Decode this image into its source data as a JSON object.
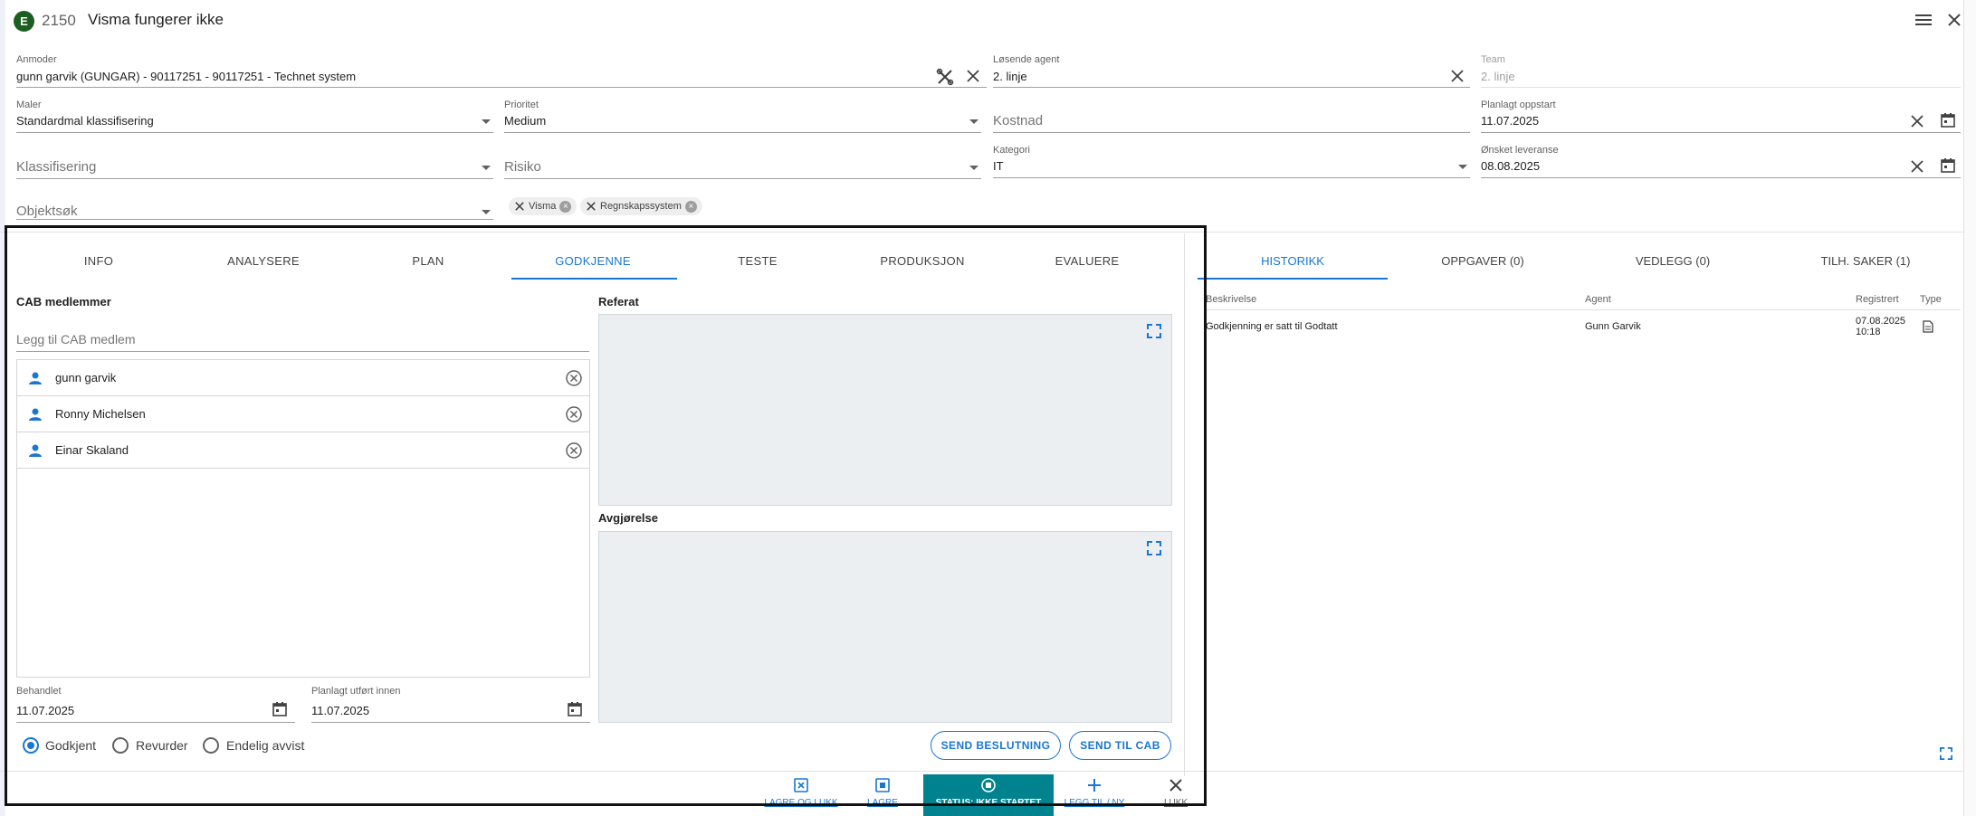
{
  "header": {
    "badge": "E",
    "case_number": "2150",
    "title": "Visma fungerer ikke"
  },
  "form": {
    "anmoder": {
      "label": "Anmoder",
      "value": "gunn garvik (GUNGAR) - 90117251 - 90117251 - Technet system"
    },
    "losende_agent": {
      "label": "Løsende agent",
      "value": "2. linje"
    },
    "team": {
      "label": "Team",
      "value": "2. linje"
    },
    "maler": {
      "label": "Maler",
      "value": "Standardmal klassifisering"
    },
    "prioritet": {
      "label": "Prioritet",
      "value": "Medium"
    },
    "kostnad": {
      "placeholder": "Kostnad"
    },
    "planlagt_oppstart": {
      "label": "Planlagt oppstart",
      "value": "11.07.2025"
    },
    "klassifisering": {
      "placeholder": "Klassifisering"
    },
    "risiko": {
      "placeholder": "Risiko"
    },
    "kategori": {
      "label": "Kategori",
      "value": "IT"
    },
    "onsket_leveranse": {
      "label": "Ønsket leveranse",
      "value": "08.08.2025"
    },
    "objektsok": {
      "placeholder": "Objektsøk"
    },
    "chips": [
      "Visma",
      "Regnskapssystem"
    ]
  },
  "tabs": [
    "INFO",
    "ANALYSERE",
    "PLAN",
    "GODKJENNE",
    "TESTE",
    "PRODUKSJON",
    "EVALUERE"
  ],
  "active_tab": "GODKJENNE",
  "cab": {
    "title": "CAB medlemmer",
    "add_placeholder": "Legg til CAB medlem",
    "members": [
      "gunn garvik",
      "Ronny Michelsen",
      "Einar Skaland"
    ]
  },
  "referat_label": "Referat",
  "avgjorelse_label": "Avgjørelse",
  "behandlet": {
    "label": "Behandlet",
    "value": "11.07.2025"
  },
  "planlagt_utfort": {
    "label": "Planlagt utført innen",
    "value": "11.07.2025"
  },
  "radios": [
    {
      "label": "Godkjent",
      "selected": true
    },
    {
      "label": "Revurder",
      "selected": false
    },
    {
      "label": "Endelig avvist",
      "selected": false
    }
  ],
  "buttons": {
    "send_beslutning": "SEND BESLUTNING",
    "send_til_cab": "SEND TIL CAB"
  },
  "right_tabs": [
    "HISTORIKK",
    "OPPGAVER (0)",
    "VEDLEGG (0)",
    "TILH. SAKER (1)"
  ],
  "history": {
    "columns": [
      "Beskrivelse",
      "Agent",
      "Registrert",
      "Type"
    ],
    "rows": [
      {
        "beskrivelse": "Godkjenning er satt til Godtatt",
        "agent": "Gunn Garvik",
        "date": "07.08.2025",
        "time": "10:18"
      }
    ]
  },
  "toolbar": {
    "lagre_og_lukk": "LAGRE OG LUKK",
    "lagre": "LAGRE",
    "status": "STATUS: IKKE STARTET",
    "legg_til_ny": "LEGG TIL / NY",
    "lukk": "LUKK"
  },
  "colors": {
    "accent": "#1976d2",
    "badge": "#1b5e20",
    "status": "#00838f"
  }
}
